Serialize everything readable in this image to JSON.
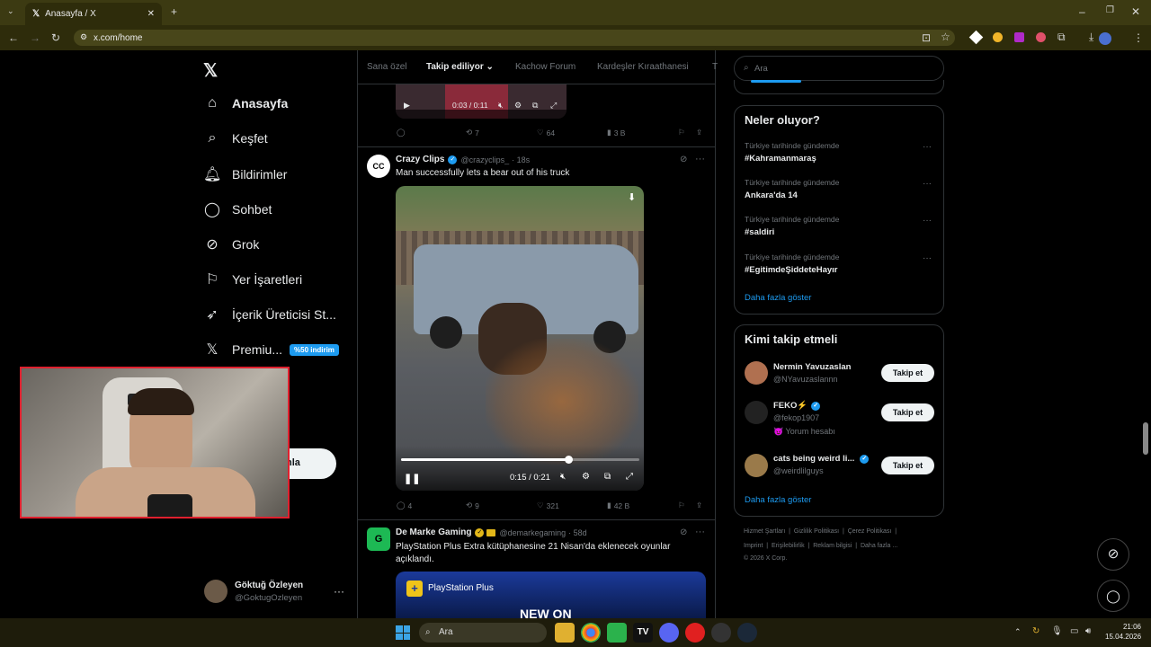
{
  "browser": {
    "tab_title": "Anasayfa / X",
    "url": "x.com/home"
  },
  "nav": {
    "home": "Anasayfa",
    "explore": "Keşfet",
    "notifications": "Bildirimler",
    "chat": "Sohbet",
    "grok": "Grok",
    "bookmarks": "Yer İşaretleri",
    "creator": "İçerik Üreticisi St...",
    "premium": "Premiu...",
    "premium_badge": "%50 indirim",
    "post_button_partial": "nla"
  },
  "account": {
    "name": "Göktuğ Özleyen",
    "handle": "@GoktugOzleyen"
  },
  "feed_tabs": [
    "Sana özel",
    "Takip ediliyor",
    "Kachow Forum",
    "Kardeşler Kıraathanesi",
    "T"
  ],
  "top_post": {
    "time": "0:03 / 0:11",
    "replies": "",
    "retweets": "7",
    "likes": "64",
    "views": "3 B"
  },
  "post2": {
    "author": "Crazy Clips",
    "handle": "@crazyclips_",
    "age": "· 18s",
    "text": "Man successfully lets a bear out of his truck",
    "time": "0:15 / 0:21",
    "progress": 0.7,
    "replies": "4",
    "retweets": "9",
    "likes": "321",
    "views": "42 B"
  },
  "post3": {
    "author": "De Marke Gaming",
    "handle": "@demarkegaming",
    "age": "· 58d",
    "text_line1": "PlayStation Plus Extra kütüphanesine 21 Nisan'da eklenecek oyunlar",
    "text_line2": "açıklandı.",
    "banner_brand": "PlayStation Plus",
    "banner_text": "NEW ON"
  },
  "search": {
    "placeholder": "Ara"
  },
  "trends": {
    "title": "Neler oluyor?",
    "items": [
      {
        "context": "Türkiye tarihinde gündemde",
        "name": "#Kahramanmaraş"
      },
      {
        "context": "Türkiye tarihinde gündemde",
        "name": "Ankara'da 14"
      },
      {
        "context": "Türkiye tarihinde gündemde",
        "name": "#saldiri"
      },
      {
        "context": "Türkiye tarihinde gündemde",
        "name": "#EgitimdeŞiddeteHayır"
      }
    ],
    "more": "Daha fazla göster"
  },
  "who_to_follow": {
    "title": "Kimi takip etmeli",
    "users": [
      {
        "name": "Nermin Yavuzaslan",
        "handle": "@NYavuzaslannn",
        "button": "Takip et"
      },
      {
        "name": "FEKO⚡",
        "handle": "@fekop1907",
        "extra": "😈 Yorum hesabı",
        "button": "Takip et"
      },
      {
        "name": "cats being weird li...",
        "handle": "@weirdlilguys",
        "button": "Takip et"
      }
    ],
    "more": "Daha fazla göster"
  },
  "footer": {
    "links": [
      "Hizmet Şartları",
      "Gizlilik Politikası",
      "Çerez Politikası",
      "Imprint",
      "Erişilebilirlik",
      "Reklam bilgisi",
      "Daha fazla ..."
    ],
    "copyright": "© 2026 X Corp."
  },
  "taskbar": {
    "search": "Ara",
    "time": "21:06",
    "date": "15.04.2026"
  },
  "colors": {
    "accent": "#1d9bf0",
    "webcam_border": "#e0202e"
  }
}
